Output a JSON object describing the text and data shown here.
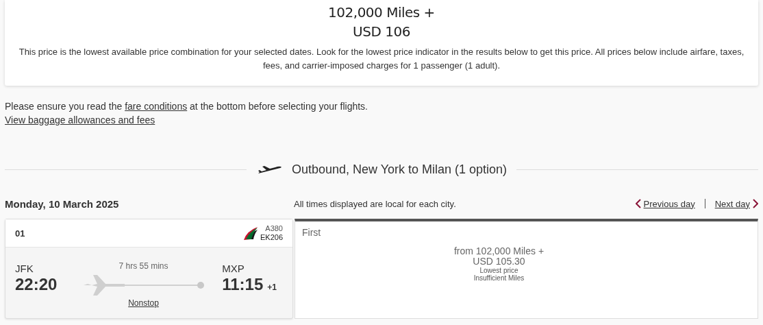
{
  "summary": {
    "miles": "102,000 Miles +",
    "cash": "USD 106",
    "note": "This price is the lowest available price combination for your selected dates. Look for the lowest price indicator in the results below to get this price. All prices below include airfare, taxes, fees, and carrier-imposed charges for 1 passenger (1 adult)."
  },
  "notice": {
    "before": "Please ensure you read the",
    "link": "fare conditions",
    "after": "at the bottom before selecting your flights."
  },
  "baggage_link": "View baggage allowances and fees",
  "section_title": "Outbound, New York to Milan (1 option)",
  "date": "Monday, 10 March 2025",
  "times_note": "All times displayed are local for each city.",
  "day_nav": {
    "previous": "Previous day",
    "next": "Next day"
  },
  "flight": {
    "number": "01",
    "aircraft": "A380",
    "flight_code": "EK206",
    "origin": "JFK",
    "departure": "22:20",
    "duration": "7 hrs 55 mins",
    "stops": "Nonstop",
    "destination": "MXP",
    "arrival": "11:15",
    "day_offset": "+1"
  },
  "fare": {
    "cabin": "First",
    "price_miles": "from 102,000 Miles +",
    "price_cash": "USD 105.30",
    "tags": [
      "Lowest price",
      "Insufficient Miles"
    ]
  }
}
